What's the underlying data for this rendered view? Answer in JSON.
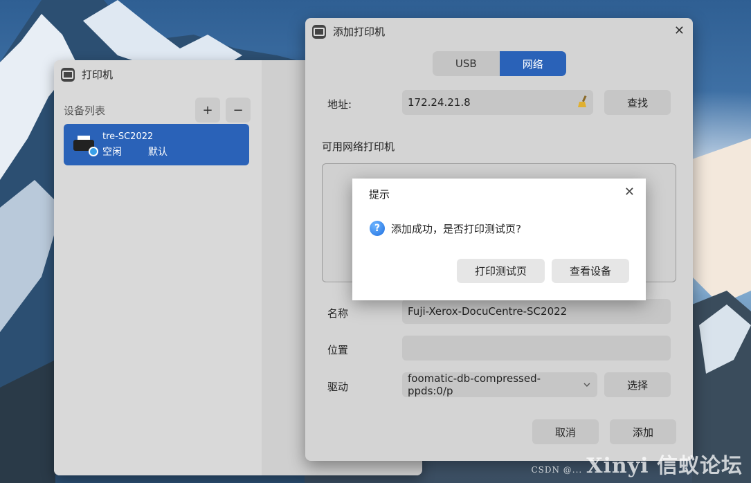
{
  "watermark": {
    "text": "Xinyi 信蚁论坛",
    "sub": "CSDN @..."
  },
  "printer_window": {
    "title": "打印机",
    "device_list_label": "设备列表",
    "add_symbol": "+",
    "remove_symbol": "−",
    "device": {
      "name": "tre-SC2022",
      "status": "空闲",
      "default_label": "默认"
    }
  },
  "add_window": {
    "title": "添加打印机",
    "close_symbol": "✕",
    "tabs": [
      {
        "label": "USB",
        "active": false
      },
      {
        "label": "网络",
        "active": true
      }
    ],
    "address_label": "地址:",
    "address_value": "172.24.21.8",
    "find_button": "查找",
    "available_label": "可用网络打印机",
    "name_label": "名称",
    "name_value": "Fuji-Xerox-DocuCentre-SC2022",
    "location_label": "位置",
    "location_value": "",
    "driver_label": "驱动",
    "driver_value": "foomatic-db-compressed-ppds:0/p",
    "select_button": "选择",
    "cancel_button": "取消",
    "add_button": "添加"
  },
  "dialog": {
    "title": "提示",
    "close_symbol": "✕",
    "icon": "question-icon",
    "message": "添加成功，是否打印测试页?",
    "print_test_button": "打印测试页",
    "view_device_button": "查看设备"
  },
  "colors": {
    "accent": "#2a62b8",
    "window_bg": "#d4d4d4",
    "dialog_bg": "#ffffff"
  }
}
